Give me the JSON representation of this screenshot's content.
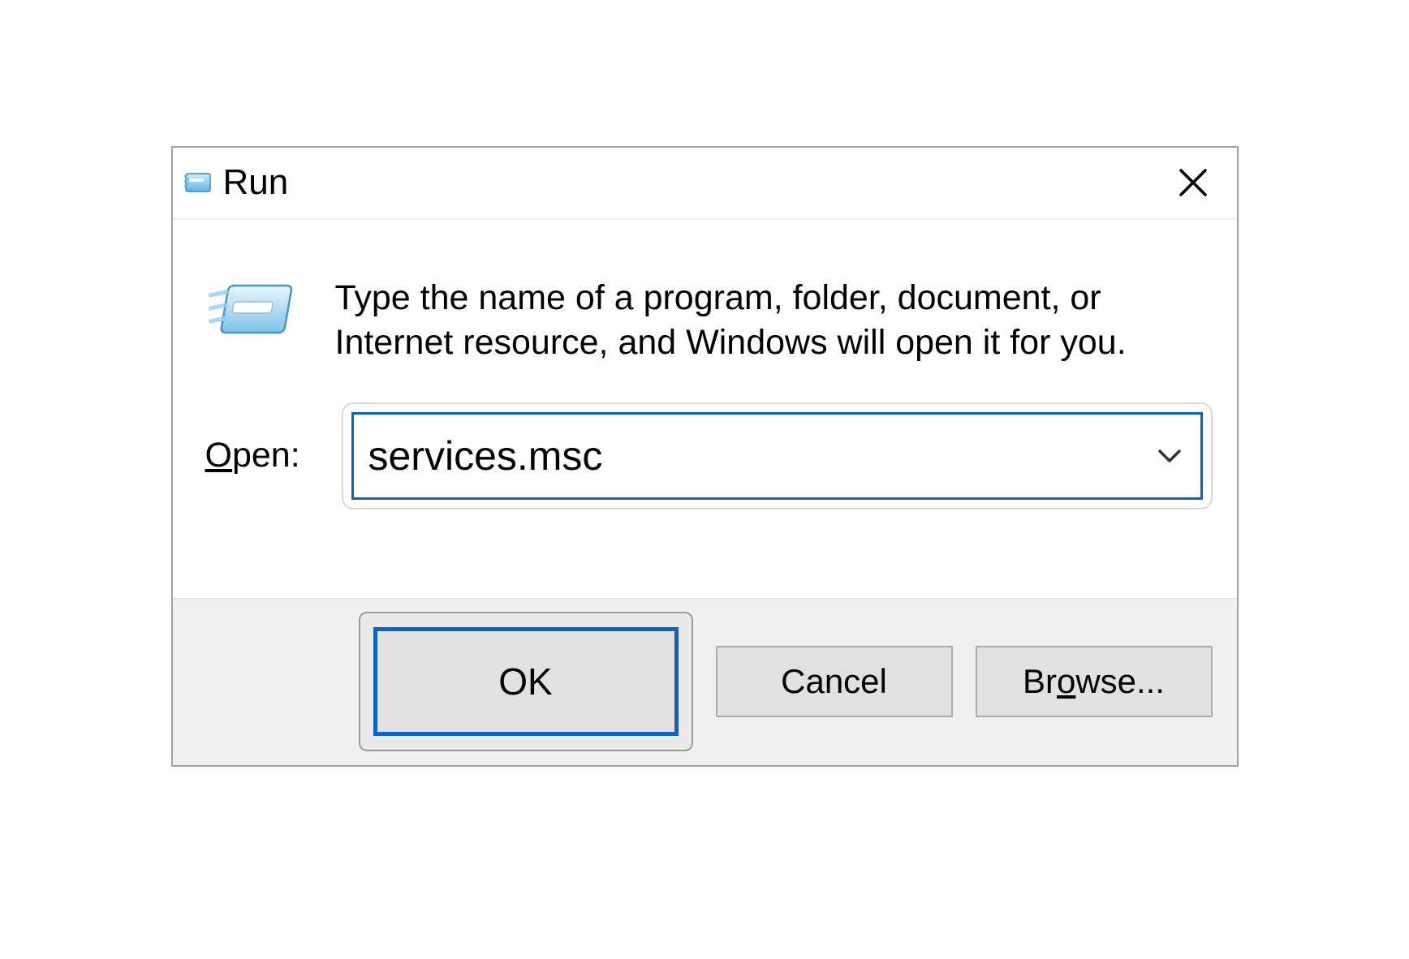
{
  "dialog": {
    "title": "Run",
    "close_tooltip": "Close",
    "description": "Type the name of a program, folder, document, or Internet resource, and Windows will open it for you.",
    "open_label_prefix_underlined": "O",
    "open_label_rest": "pen:",
    "input_value": "services.msc",
    "buttons": {
      "ok": "OK",
      "cancel": "Cancel",
      "browse_prefix": "Br",
      "browse_underlined": "o",
      "browse_rest": "wse..."
    }
  }
}
